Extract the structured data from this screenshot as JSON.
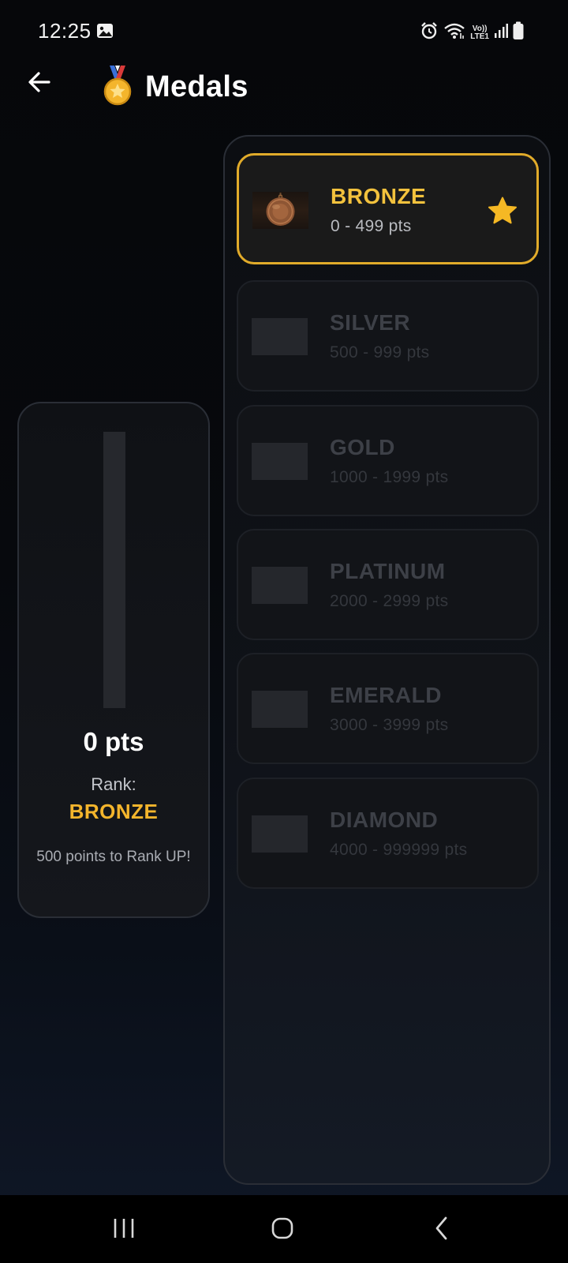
{
  "status_bar": {
    "time": "12:25",
    "network_label_top": "Vo))",
    "network_label_bottom": "LTE1",
    "icons": [
      "gallery-icon",
      "alarm-icon",
      "wifi-icon",
      "signal-icon",
      "battery-icon"
    ]
  },
  "app_bar": {
    "title": "Medals",
    "title_icon": "medal-icon",
    "back_icon": "back-arrow-icon"
  },
  "progress": {
    "points": "0 pts",
    "rank_label": "Rank:",
    "rank_value": "BRONZE",
    "rankup_message": "500 points to Rank UP!",
    "fill_fraction": 0,
    "colors": {
      "rank": "#f4b52c",
      "track": "#26282d"
    }
  },
  "medals": [
    {
      "name": "BRONZE",
      "range": "0 - 499 pts",
      "active": true,
      "icon": "bronze-medal-icon"
    },
    {
      "name": "SILVER",
      "range": "500 - 999 pts",
      "active": false
    },
    {
      "name": "GOLD",
      "range": "1000 - 1999 pts",
      "active": false
    },
    {
      "name": "PLATINUM",
      "range": "2000 - 2999 pts",
      "active": false
    },
    {
      "name": "EMERALD",
      "range": "3000 - 3999 pts",
      "active": false
    },
    {
      "name": "DIAMOND",
      "range": "4000 - 999999 pts",
      "active": false
    }
  ],
  "theme": {
    "accent": "#e1ab2a",
    "active_title": "#f3c23d",
    "star": "#f5b824"
  },
  "nav_bar": {
    "icons": [
      "recent-apps-icon",
      "home-icon",
      "back-icon"
    ]
  }
}
